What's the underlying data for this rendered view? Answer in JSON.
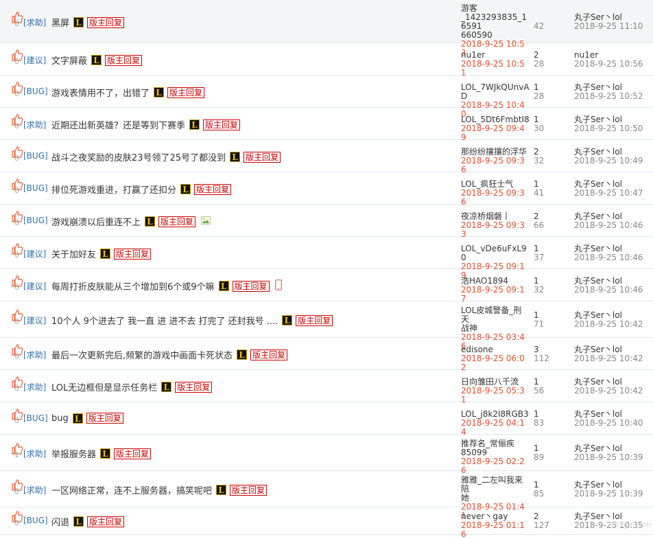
{
  "topics": [
    {
      "likes": "0",
      "tag": "[求助]",
      "title": "黑屏",
      "badge": "L",
      "reply": "版主回复",
      "extra": "",
      "author": [
        "游客",
        "_1423293835_16591",
        "660590"
      ],
      "date": "2018-9-25 10:53",
      "replies": "",
      "views": "42",
      "last_user": "丸子Ser丶lol",
      "last_time": "2018-9-25 11:10"
    },
    {
      "likes": "0",
      "tag": "[建议]",
      "title": "文字屏蔽",
      "badge": "L",
      "reply": "版主回复",
      "extra": "",
      "author": [
        "nu1er"
      ],
      "date": "2018-9-25 10:51",
      "replies": "2",
      "views": "28",
      "last_user": "nu1er",
      "last_time": "2018-9-25 10:56"
    },
    {
      "likes": "0",
      "tag": "[BUG]",
      "title": "游戏表情用不了，出错了",
      "badge": "L",
      "reply": "版主回复",
      "extra": "",
      "author": [
        "LOL_7WJkQUnvAD"
      ],
      "date": "2018-9-25 10:40",
      "replies": "1",
      "views": "28",
      "last_user": "丸子Ser丶lol",
      "last_time": "2018-9-25 10:52"
    },
    {
      "likes": "0",
      "tag": "[求助]",
      "title": "近期还出新英雄？还是等到下赛季",
      "badge": "L",
      "reply": "版主回复",
      "extra": "",
      "author": [
        "LOL_5Dt6FmbtI8"
      ],
      "date": "2018-9-25 09:49",
      "replies": "1",
      "views": "30",
      "last_user": "丸子Ser丶lol",
      "last_time": "2018-9-25 10:50"
    },
    {
      "likes": "0",
      "tag": "[BUG]",
      "title": "战斗之夜奖励的皮肤23号领了25号了都没到",
      "badge": "L",
      "reply": "版主回复",
      "extra": "",
      "author": [
        "那纷纷攘攘的浮华"
      ],
      "date": "2018-9-25 09:36",
      "replies": "2",
      "views": "32",
      "last_user": "丸子Ser丶lol",
      "last_time": "2018-9-25 10:49"
    },
    {
      "likes": "0",
      "tag": "[BUG]",
      "title": "排位死游戏重进，打赢了还扣分",
      "badge": "L",
      "reply": "版主回复",
      "extra": "",
      "author": [
        "LOL_疯狂士气"
      ],
      "date": "2018-9-25 09:36",
      "replies": "1",
      "views": "41",
      "last_user": "丸子Ser丶lol",
      "last_time": "2018-9-25 10:47"
    },
    {
      "likes": "0",
      "tag": "[BUG]",
      "title": "游戏崩溃以后重连不上",
      "badge": "L",
      "reply": "版主回复",
      "extra": "image",
      "author": [
        "夜凉桥烟磐丨"
      ],
      "date": "2018-9-25 09:33",
      "replies": "2",
      "views": "66",
      "last_user": "丸子Ser丶lol",
      "last_time": "2018-9-25 10:46"
    },
    {
      "likes": "0",
      "tag": "[建议]",
      "title": "关于加好友",
      "badge": "L",
      "reply": "版主回复",
      "extra": "",
      "author": [
        "LOL_vDe6uFxL90"
      ],
      "date": "2018-9-25 09:19",
      "replies": "1",
      "views": "37",
      "last_user": "丸子Ser丶lol",
      "last_time": "2018-9-25 10:46"
    },
    {
      "likes": "0",
      "tag": "[建议]",
      "title": "每周打折皮肤能从三个增加到6个或9个嘛",
      "badge": "L",
      "reply": "版主回复",
      "extra": "mobile",
      "author": [
        "浩HAO1894"
      ],
      "date": "2018-9-25 09:17",
      "replies": "1",
      "views": "32",
      "last_user": "丸子Ser丶lol",
      "last_time": "2018-9-25 10:46"
    },
    {
      "likes": "0",
      "tag": "[建议]",
      "title": "10个人 9个进去了 我一直 进 进不去 打完了 还封我号 ....",
      "badge": "L",
      "reply": "版主回复",
      "extra": "",
      "author": [
        "LOL皮城警备_刑天",
        "战神"
      ],
      "date": "2018-9-25 03:46",
      "replies": "1",
      "views": "71",
      "last_user": "丸子Ser丶lol",
      "last_time": "2018-9-25 10:42"
    },
    {
      "likes": "0",
      "tag": "[求助]",
      "title": "最后一次更新完后,频繁的游戏中画面卡死状态",
      "badge": "L",
      "reply": "版主回复",
      "extra": "",
      "author": [
        "edisone"
      ],
      "date": "2018-9-25 06:02",
      "replies": "3",
      "views": "112",
      "last_user": "丸子Ser丶lol",
      "last_time": "2018-9-25 10:42"
    },
    {
      "likes": "0",
      "tag": "[求助]",
      "title": "LOL无边框但是显示任务栏",
      "badge": "L",
      "reply": "版主回复",
      "extra": "",
      "author": [
        "日向雏田八千流"
      ],
      "date": "2018-9-25 05:31",
      "replies": "1",
      "views": "56",
      "last_user": "丸子Ser丶lol",
      "last_time": "2018-9-25 10:42"
    },
    {
      "likes": "0",
      "tag": "[BUG]",
      "title": "bug",
      "badge": "L",
      "reply": "版主回复",
      "extra": "",
      "author": [
        "LOL_j8k2I8RGB3"
      ],
      "date": "2018-9-25 04:14",
      "replies": "1",
      "views": "83",
      "last_user": "丸子Ser丶lol",
      "last_time": "2018-9-25 10:40"
    },
    {
      "likes": "1",
      "tag": "[求助]",
      "title": "举报服务器",
      "badge": "L",
      "reply": "版主回复",
      "extra": "",
      "author": [
        "推荐名_常俪疾",
        "85099"
      ],
      "date": "2018-9-25 02:26",
      "replies": "1",
      "views": "89",
      "last_user": "丸子Ser丶lol",
      "last_time": "2018-9-25 10:39"
    },
    {
      "likes": "0",
      "tag": "[求助]",
      "title": "一区网络正常，连不上服务器，搞笑呢吧",
      "badge": "L",
      "reply": "版主回复",
      "extra": "",
      "author": [
        "雅雅_二左叫我来陪",
        "她"
      ],
      "date": "2018-9-25 01:41",
      "replies": "1",
      "views": "85",
      "last_user": "丸子Ser丶lol",
      "last_time": "2018-9-25 10:39"
    },
    {
      "likes": "0",
      "tag": "[BUG]",
      "title": "闪退",
      "badge": "L",
      "reply": "版主回复",
      "extra": "",
      "author": [
        "never丶gay"
      ],
      "date": "2018-9-25 01:16",
      "replies": "2",
      "views": "127",
      "last_user": "丸子Ser丶lol",
      "last_time": "2018-9-25 10:35"
    }
  ],
  "watermark": "983go.com",
  "colors": {
    "tag": "#2f6fb0",
    "date": "#e0502f",
    "reply_border": "#cc0000",
    "highlight_row": "#f4f5f7"
  }
}
